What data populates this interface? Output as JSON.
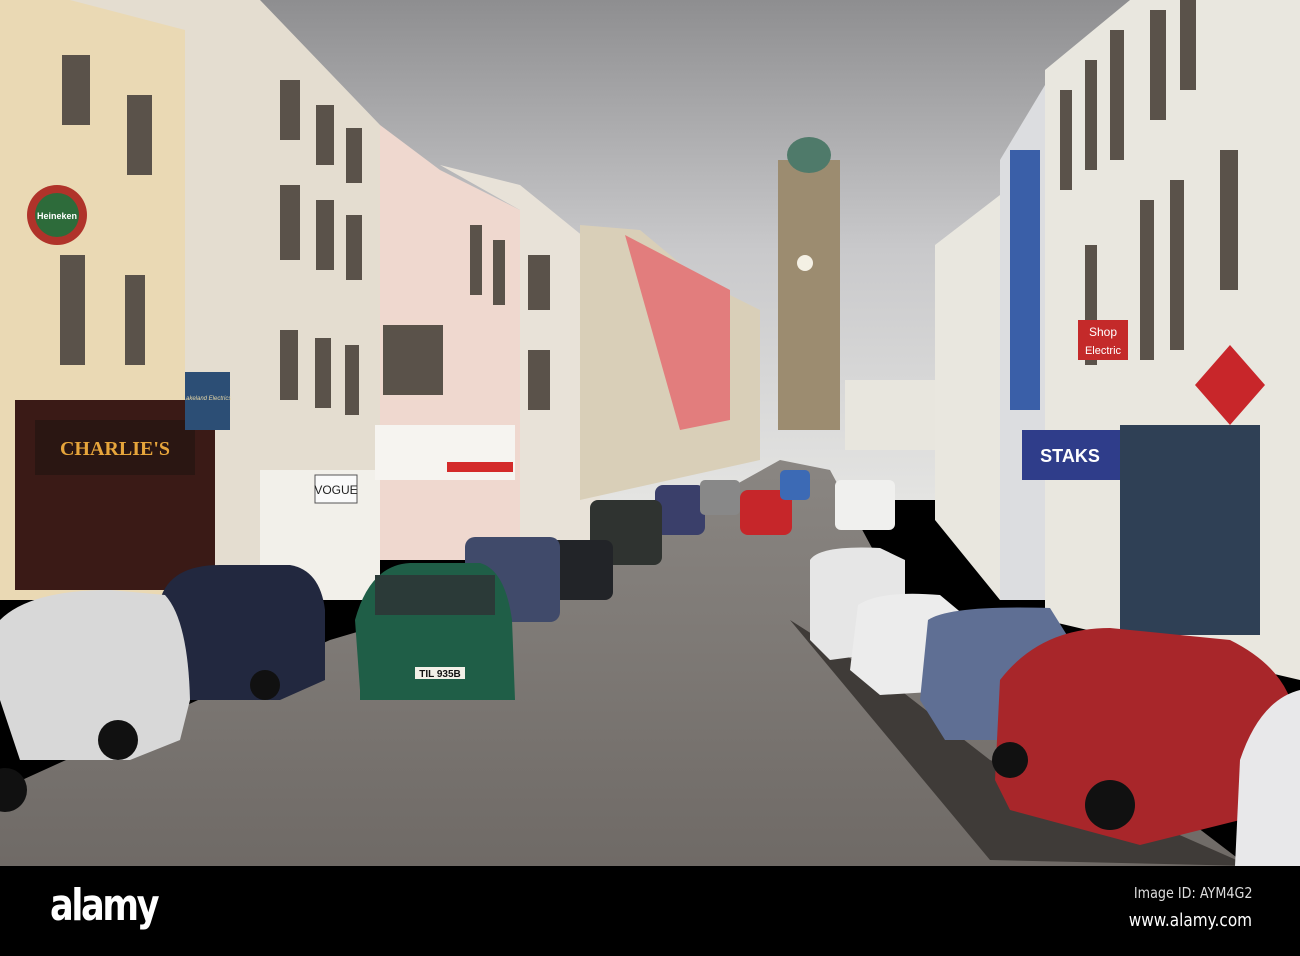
{
  "photo": {
    "signs": {
      "charlies": "CHARLIE'S",
      "vogue": "VOGUE",
      "lakeland": "Lakeland Electrics",
      "heineken": "Heineken",
      "shop_electric_1": "Shop",
      "shop_electric_2": "Electric",
      "staks": "STAKS",
      "plate": "TIL 935B"
    }
  },
  "watermark": {
    "logo": "alamy",
    "image_id": "Image ID: AYM4G2",
    "website": "www.alamy.com"
  }
}
